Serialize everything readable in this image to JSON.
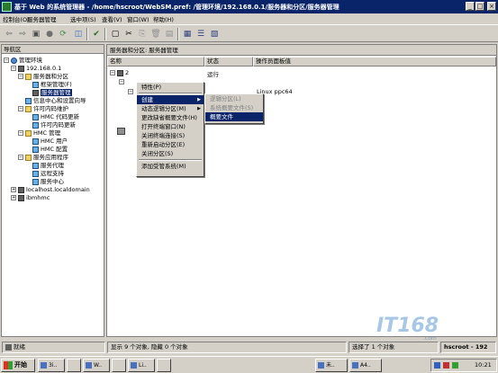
{
  "window": {
    "title": "基于 Web 的系统管理器 - /home/hscroot/WebSM.pref: /管理环境/192.168.0.1/服务器和分区/服务器管理"
  },
  "menubar": [
    "控制台(O)",
    "服务器管理",
    "选中项(S)",
    "查看(V)",
    "窗口(W)",
    "帮助(H)"
  ],
  "left_pane": {
    "header": "导航区",
    "tree": [
      {
        "label": "管理环境"
      },
      {
        "label": "192.168.0.1"
      },
      {
        "label": "服务器和分区"
      },
      {
        "label": "框架管理(F)"
      },
      {
        "label": "服务器管理"
      },
      {
        "label": "信息中心和设置向导"
      },
      {
        "label": "许可内码维护"
      },
      {
        "label": "HMC 代码更新"
      },
      {
        "label": "许可内码更新"
      },
      {
        "label": "HMC 管理"
      },
      {
        "label": "HMC 用户"
      },
      {
        "label": "HMC 配置"
      },
      {
        "label": "服务应用程序"
      },
      {
        "label": "服务代理"
      },
      {
        "label": "远程支持"
      },
      {
        "label": "服务中心"
      },
      {
        "label": "localhost.localdomain"
      },
      {
        "label": "ibmhmc"
      }
    ]
  },
  "right_pane": {
    "header": "服务器和分区: 服务器管理",
    "columns": [
      "名称",
      "状态",
      "操作员面板值"
    ],
    "rows": [
      {
        "name": "2",
        "status": "运行",
        "panel": ""
      },
      {
        "name": "",
        "status": "",
        "panel": "Linux ppc64"
      }
    ]
  },
  "context_menu": {
    "items": [
      "特性(P)",
      "创建",
      "动态逻辑分区(M)",
      "更改缺省概要文件(H)",
      "打开终端窗口(N)",
      "关闭终端连接(S)",
      "重新启动分区(E)",
      "关闭分区(S)",
      "添加受管系统(M)"
    ]
  },
  "submenu": {
    "items": [
      "逻辑分区(L)",
      "系统概要文件(S)",
      "概要文件"
    ]
  },
  "status_bar": {
    "ready": "就绪",
    "shown": "显示 9 个对象, 隐藏 0 个对象",
    "selected": "选择了 1 个对象",
    "user": "hscroot - 192"
  },
  "taskbar": {
    "start": "开始",
    "tasks": [
      "3i..",
      "",
      "W..",
      "",
      "Li..",
      "",
      "未..",
      "A4.."
    ],
    "clock": "10:21"
  },
  "watermark": "IT168",
  "watermark_sub": ".com"
}
